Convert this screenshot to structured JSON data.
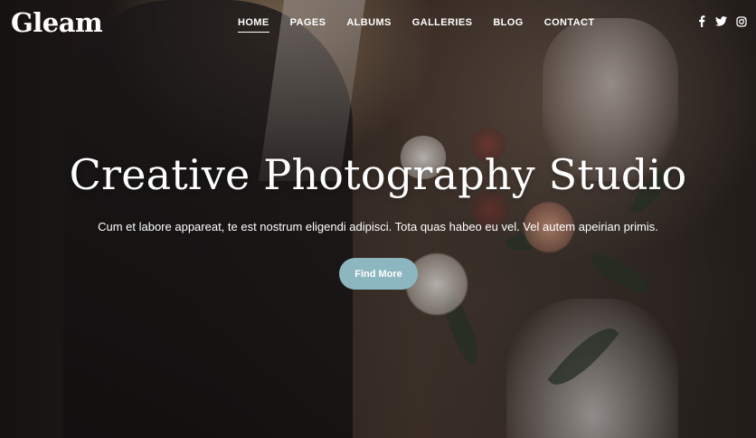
{
  "site": {
    "logo": "Gleam"
  },
  "nav": {
    "items": [
      {
        "label": "HOME",
        "active": true
      },
      {
        "label": "PAGES",
        "active": false
      },
      {
        "label": "ALBUMS",
        "active": false
      },
      {
        "label": "GALLERIES",
        "active": false
      },
      {
        "label": "BLOG",
        "active": false
      },
      {
        "label": "CONTACT",
        "active": false
      }
    ]
  },
  "social": {
    "icons": [
      {
        "name": "facebook-icon",
        "glyph": "f"
      },
      {
        "name": "twitter-icon",
        "glyph": "t"
      },
      {
        "name": "instagram-icon",
        "glyph": "◎"
      }
    ]
  },
  "hero": {
    "title": "Creative Photography Studio",
    "subtitle": "Cum et labore appareat, te est nostrum eligendi adipisci. Tota quas habeo eu vel. Vel autem apeirian primis.",
    "button_label": "Find More"
  },
  "colors": {
    "accent": "#8db7c0",
    "text": "#ffffff"
  }
}
